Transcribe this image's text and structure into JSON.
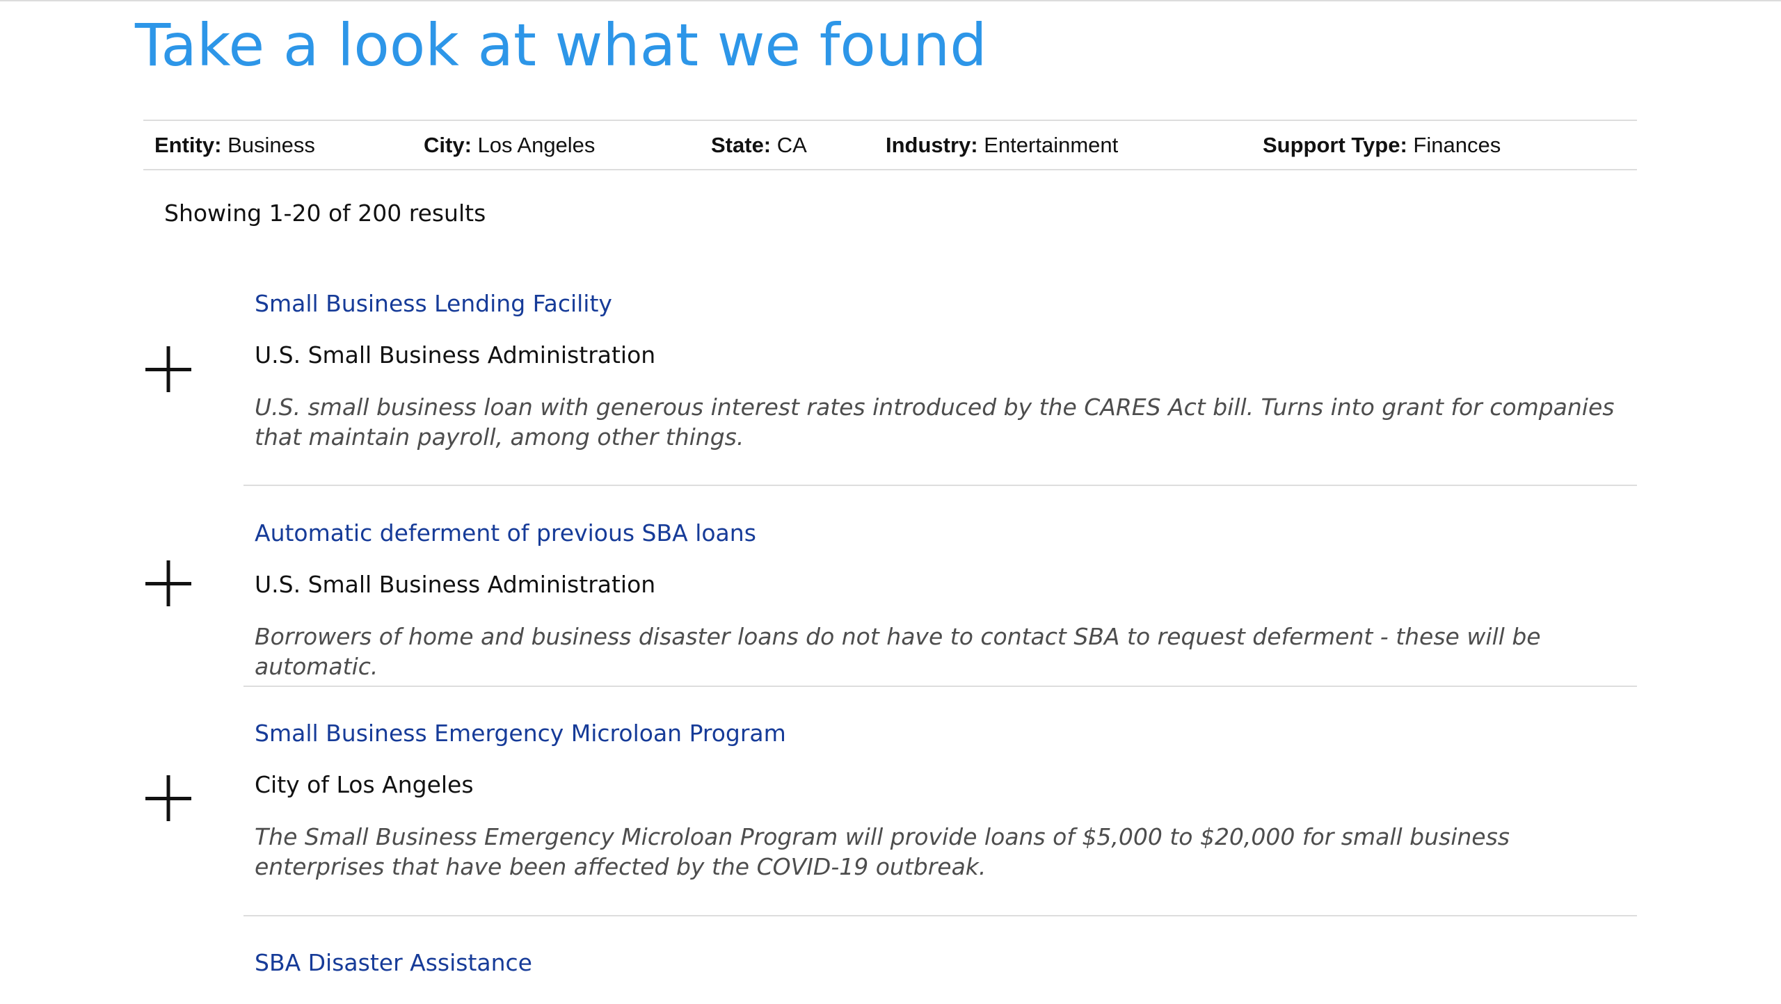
{
  "header": {
    "title": "Take a look at what we found"
  },
  "filters": [
    {
      "label": "Entity:",
      "value": "Business"
    },
    {
      "label": "City:",
      "value": "Los Angeles"
    },
    {
      "label": "State:",
      "value": "CA"
    },
    {
      "label": "Industry:",
      "value": "Entertainment"
    },
    {
      "label": "Support Type:",
      "value": "Finances"
    }
  ],
  "results_summary": "Showing 1-20 of 200 results",
  "expand_icon": "plus-icon",
  "results": [
    {
      "title": "Small Business Lending Facility",
      "agency": "U.S. Small Business Administration",
      "description": "U.S. small business loan with generous interest rates introduced by the CARES Act bill. Turns into grant for companies that maintain payroll, among other things."
    },
    {
      "title": "Automatic deferment of previous SBA loans",
      "agency": "U.S. Small Business Administration",
      "description": "Borrowers of home and business disaster loans do not have to contact SBA to request deferment - these will be automatic."
    },
    {
      "title": "Small Business Emergency Microloan Program",
      "agency": "City of Los Angeles",
      "description": "The Small Business Emergency Microloan Program will provide loans of $5,000 to $20,000 for small business enterprises that have been affected by the COVID-19 outbreak."
    },
    {
      "title": "SBA Disaster Assistance"
    }
  ]
}
